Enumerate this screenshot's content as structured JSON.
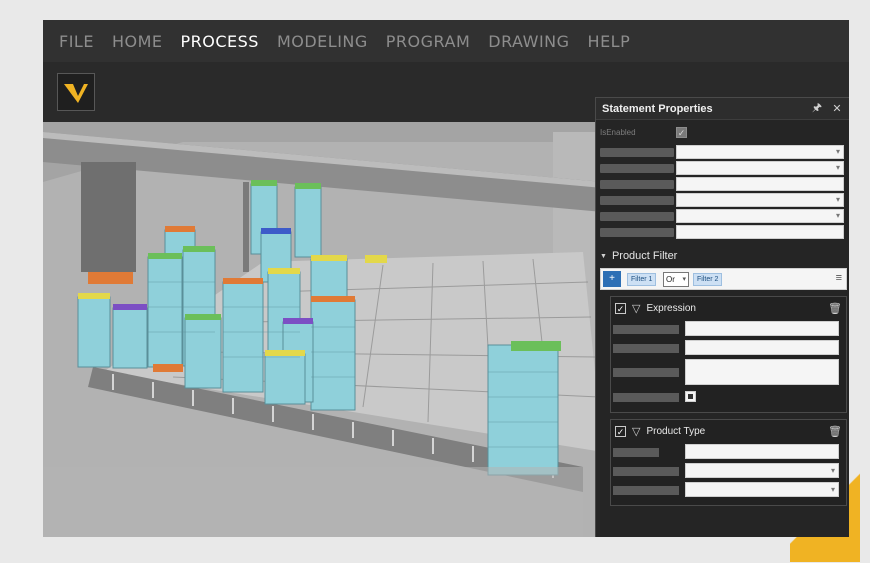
{
  "menu": {
    "items": [
      {
        "label": "FILE"
      },
      {
        "label": "HOME"
      },
      {
        "label": "PROCESS",
        "active": true
      },
      {
        "label": "MODELING"
      },
      {
        "label": "PROGRAM"
      },
      {
        "label": "DRAWING"
      },
      {
        "label": "HELP"
      }
    ]
  },
  "colors": {
    "accent_yellow": "#f0b323",
    "crate_cyan": "#8fd0da",
    "menu_active": "#ffffff",
    "menu_inactive": "#8d8d8d",
    "filter_button_blue": "#2d6fb5"
  },
  "panel": {
    "title": "Statement Properties",
    "pin_icon": "pin-icon",
    "close_icon": "close-icon",
    "is_enabled_label": "IsEnabled",
    "is_enabled_checked": true,
    "product_filter": {
      "title": "Product Filter",
      "filter_1": "Filter 1",
      "operator": "Or",
      "filter_2": "Filter 2"
    },
    "expression_card": {
      "title": "Expression",
      "checked": true
    },
    "product_type_card": {
      "title": "Product Type",
      "checked": true
    }
  }
}
